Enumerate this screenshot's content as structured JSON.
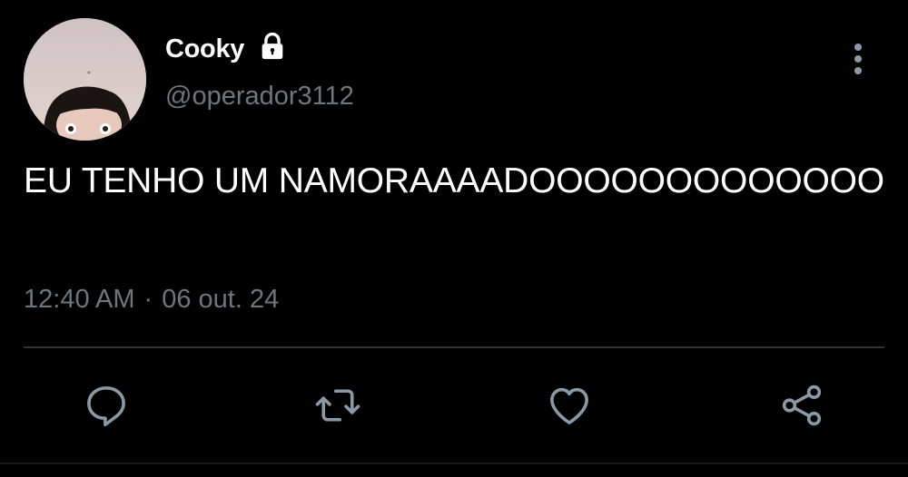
{
  "user": {
    "display_name": "Cooky",
    "handle": "@operador3112",
    "protected_icon": "lock-icon",
    "avatar": "avatar-photo"
  },
  "tweet": {
    "text": "EU TENHO UM NAMORAAAADOOOOOOOOOOOOO",
    "time": "12:40 AM",
    "separator": "·",
    "date": "06 out. 24"
  },
  "actions": [
    {
      "name": "reply",
      "icon": "reply-icon"
    },
    {
      "name": "retweet",
      "icon": "retweet-icon"
    },
    {
      "name": "like",
      "icon": "heart-icon"
    },
    {
      "name": "share",
      "icon": "share-icon"
    }
  ],
  "colors": {
    "background": "#000000",
    "text": "#ffffff",
    "secondary_text": "#6e767d",
    "divider": "#2f3336",
    "icon": "#8b98a5"
  }
}
